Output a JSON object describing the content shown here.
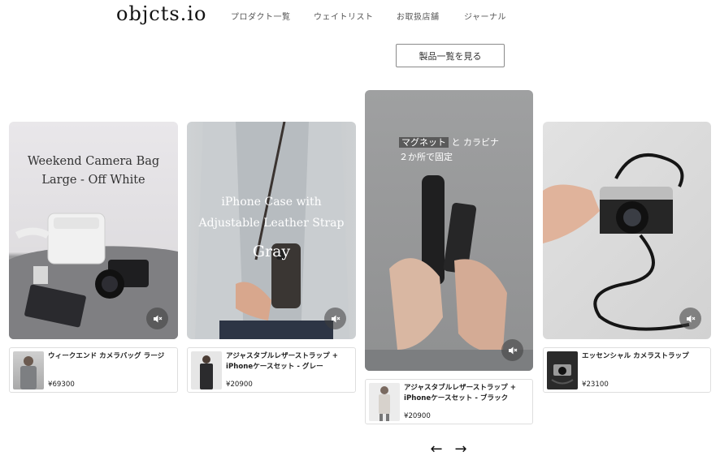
{
  "header": {
    "logo": "objcts.io",
    "nav": [
      "プロダクト一覧",
      "ウェイトリスト",
      "お取扱店舗",
      "ジャーナル"
    ]
  },
  "cta": {
    "label": "製品一覧を見る"
  },
  "cards": [
    {
      "overlay": [
        "Weekend Camera Bag",
        "Large -  Off White"
      ],
      "name": "ウィークエンド カメラバッグ ラージ",
      "price": "¥69300"
    },
    {
      "overlay": [
        "iPhone Case with",
        "Adjustable Leather Strap",
        "Gray"
      ],
      "name": "アジャスタブルレザーストラップ + iPhoneケースセット - グレー",
      "price": "¥20900"
    },
    {
      "overlay_highlight": "マグネット",
      "overlay_rest": "と カラビナ",
      "overlay_line2": "２か所で固定",
      "name": "アジャスタブルレザーストラップ + iPhoneケースセット - ブラック",
      "price": "¥20900"
    },
    {
      "name": "エッセンシャル カメラストラップ",
      "price": "¥23100"
    }
  ],
  "pager": {
    "prev": "←",
    "next": "→"
  },
  "icons": {
    "mute": "mute-speaker-icon"
  }
}
